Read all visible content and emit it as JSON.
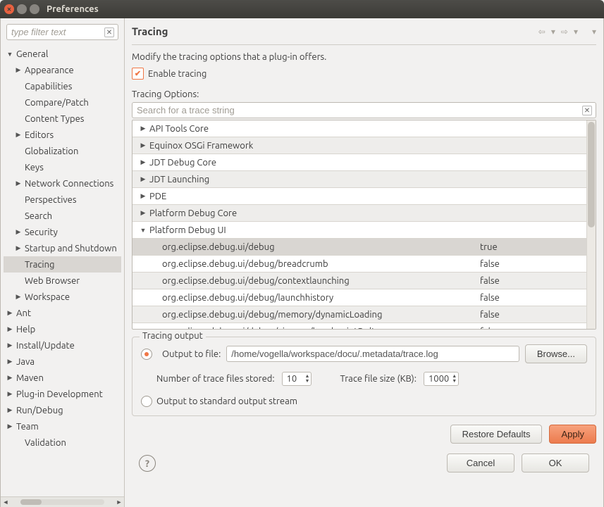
{
  "window": {
    "title": "Preferences"
  },
  "sidebar": {
    "filter_placeholder": "type filter text",
    "items": [
      {
        "label": "General",
        "expand": true,
        "depth": 0,
        "expanded": true
      },
      {
        "label": "Appearance",
        "expand": true,
        "depth": 1
      },
      {
        "label": "Capabilities",
        "expand": false,
        "depth": 1
      },
      {
        "label": "Compare/Patch",
        "expand": false,
        "depth": 1
      },
      {
        "label": "Content Types",
        "expand": false,
        "depth": 1
      },
      {
        "label": "Editors",
        "expand": true,
        "depth": 1
      },
      {
        "label": "Globalization",
        "expand": false,
        "depth": 1
      },
      {
        "label": "Keys",
        "expand": false,
        "depth": 1
      },
      {
        "label": "Network Connections",
        "expand": true,
        "depth": 1
      },
      {
        "label": "Perspectives",
        "expand": false,
        "depth": 1
      },
      {
        "label": "Search",
        "expand": false,
        "depth": 1
      },
      {
        "label": "Security",
        "expand": true,
        "depth": 1
      },
      {
        "label": "Startup and Shutdown",
        "expand": true,
        "depth": 1
      },
      {
        "label": "Tracing",
        "expand": false,
        "depth": 1,
        "selected": true
      },
      {
        "label": "Web Browser",
        "expand": false,
        "depth": 1
      },
      {
        "label": "Workspace",
        "expand": true,
        "depth": 1
      },
      {
        "label": "Ant",
        "expand": true,
        "depth": 0
      },
      {
        "label": "Help",
        "expand": true,
        "depth": 0
      },
      {
        "label": "Install/Update",
        "expand": true,
        "depth": 0
      },
      {
        "label": "Java",
        "expand": true,
        "depth": 0
      },
      {
        "label": "Maven",
        "expand": true,
        "depth": 0
      },
      {
        "label": "Plug-in Development",
        "expand": true,
        "depth": 0
      },
      {
        "label": "Run/Debug",
        "expand": true,
        "depth": 0
      },
      {
        "label": "Team",
        "expand": true,
        "depth": 0
      },
      {
        "label": "Validation",
        "expand": false,
        "depth": 1
      }
    ]
  },
  "page": {
    "title": "Tracing",
    "description": "Modify the tracing options that a plug-in offers.",
    "enable_label": "Enable tracing",
    "options_label": "Tracing Options:",
    "search_placeholder": "Search for a trace string"
  },
  "table": {
    "rows": [
      {
        "label": "API Tools Core",
        "expand": true,
        "depth": 0,
        "val": ""
      },
      {
        "label": "Equinox OSGi Framework",
        "expand": true,
        "depth": 0,
        "val": ""
      },
      {
        "label": "JDT Debug Core",
        "expand": true,
        "depth": 0,
        "val": ""
      },
      {
        "label": "JDT Launching",
        "expand": true,
        "depth": 0,
        "val": ""
      },
      {
        "label": "PDE",
        "expand": true,
        "depth": 0,
        "val": ""
      },
      {
        "label": "Platform Debug Core",
        "expand": true,
        "depth": 0,
        "val": ""
      },
      {
        "label": "Platform Debug UI",
        "expand": true,
        "expanded": true,
        "depth": 0,
        "val": ""
      },
      {
        "label": "org.eclipse.debug.ui/debug",
        "expand": false,
        "depth": 1,
        "val": "true",
        "sel": true
      },
      {
        "label": "org.eclipse.debug.ui/debug/breadcrumb",
        "expand": false,
        "depth": 1,
        "val": "false"
      },
      {
        "label": "org.eclipse.debug.ui/debug/contextlaunching",
        "expand": false,
        "depth": 1,
        "val": "false"
      },
      {
        "label": "org.eclipse.debug.ui/debug/launchhistory",
        "expand": false,
        "depth": 1,
        "val": "false"
      },
      {
        "label": "org.eclipse.debug.ui/debug/memory/dynamicLoading",
        "expand": false,
        "depth": 1,
        "val": "false"
      },
      {
        "label": "org.eclipse.debug.ui/debug/viewers/breakpointDeltas",
        "expand": false,
        "depth": 1,
        "val": "false"
      }
    ]
  },
  "output": {
    "legend": "Tracing output",
    "to_file_label": "Output to file:",
    "file_path": "/home/vogella/workspace/docu/.metadata/trace.log",
    "browse": "Browse...",
    "num_files_label": "Number of trace files stored:",
    "num_files": "10",
    "size_label": "Trace file size (KB):",
    "size": "1000",
    "to_stdout_label": "Output to standard output stream"
  },
  "buttons": {
    "restore": "Restore Defaults",
    "apply": "Apply",
    "cancel": "Cancel",
    "ok": "OK"
  }
}
